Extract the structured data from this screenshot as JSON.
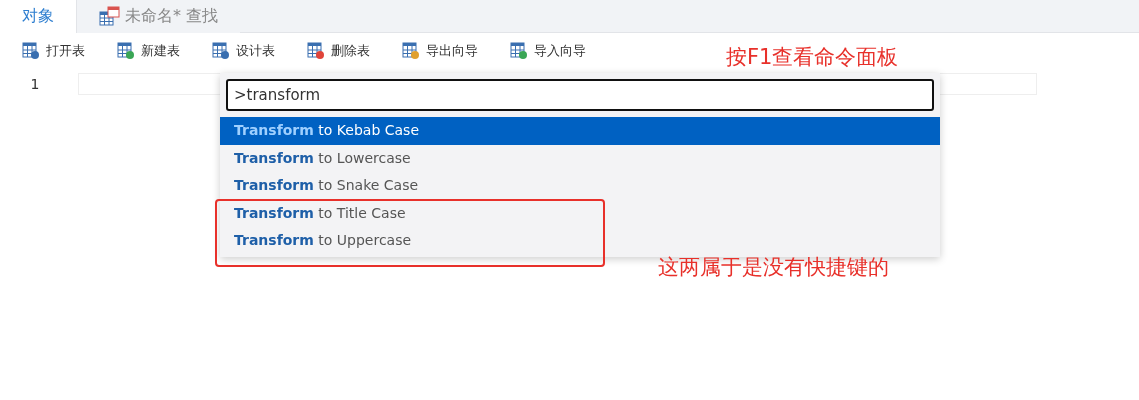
{
  "tabs": [
    {
      "label": "对象",
      "selected": true
    },
    {
      "label": "未命名* 查找",
      "selected": false
    }
  ],
  "toolbar": [
    "打开表",
    "新建表",
    "设计表",
    "删除表",
    "导出向导",
    "导入向导"
  ],
  "editor": {
    "line_numbers": [
      "1"
    ]
  },
  "command_palette": {
    "input": ">transform",
    "items": [
      {
        "label": "**Transform** to Kebab Case",
        "selected": true
      },
      {
        "label": "**Transform** to Lowercase",
        "selected": false
      },
      {
        "label": "**Transform** to Snake Case",
        "selected": false
      },
      {
        "label": "**Transform** to Title Case",
        "selected": false
      },
      {
        "label": "**Transform** to Uppercase",
        "selected": false
      }
    ]
  },
  "annotations": [
    "按F1查看命令面板",
    "这两属于是没有快捷键的"
  ]
}
